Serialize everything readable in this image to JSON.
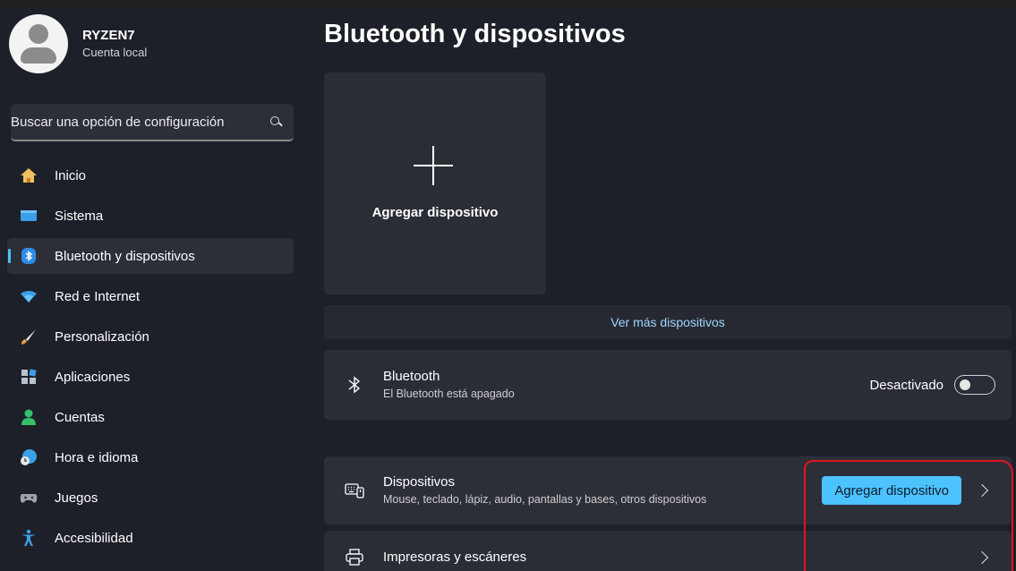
{
  "profile": {
    "name": "RYZEN7",
    "account": "Cuenta local"
  },
  "search": {
    "placeholder": "Buscar una opción de configuración"
  },
  "nav": [
    {
      "label": "Inicio",
      "icon": "home-icon"
    },
    {
      "label": "Sistema",
      "icon": "monitor-icon"
    },
    {
      "label": "Bluetooth y dispositivos",
      "icon": "bluetooth-icon",
      "active": true
    },
    {
      "label": "Red e Internet",
      "icon": "wifi-icon"
    },
    {
      "label": "Personalización",
      "icon": "brush-icon"
    },
    {
      "label": "Aplicaciones",
      "icon": "apps-icon"
    },
    {
      "label": "Cuentas",
      "icon": "person-icon"
    },
    {
      "label": "Hora e idioma",
      "icon": "clock-globe-icon"
    },
    {
      "label": "Juegos",
      "icon": "gamepad-icon"
    },
    {
      "label": "Accesibilidad",
      "icon": "accessibility-icon"
    }
  ],
  "main": {
    "title": "Bluetooth y dispositivos",
    "add_tile_label": "Agregar dispositivo",
    "more_devices": "Ver más dispositivos",
    "bluetooth": {
      "title": "Bluetooth",
      "subtitle": "El Bluetooth está apagado",
      "state": "Desactivado"
    },
    "devices": {
      "title": "Dispositivos",
      "subtitle": "Mouse, teclado, lápiz, audio, pantallas y bases, otros dispositivos",
      "button": "Agregar dispositivo"
    },
    "printers": {
      "title": "Impresoras y escáneres"
    }
  },
  "colors": {
    "accent": "#4cc2ff",
    "annotation": "#e0141e",
    "background": "#1d2029"
  }
}
